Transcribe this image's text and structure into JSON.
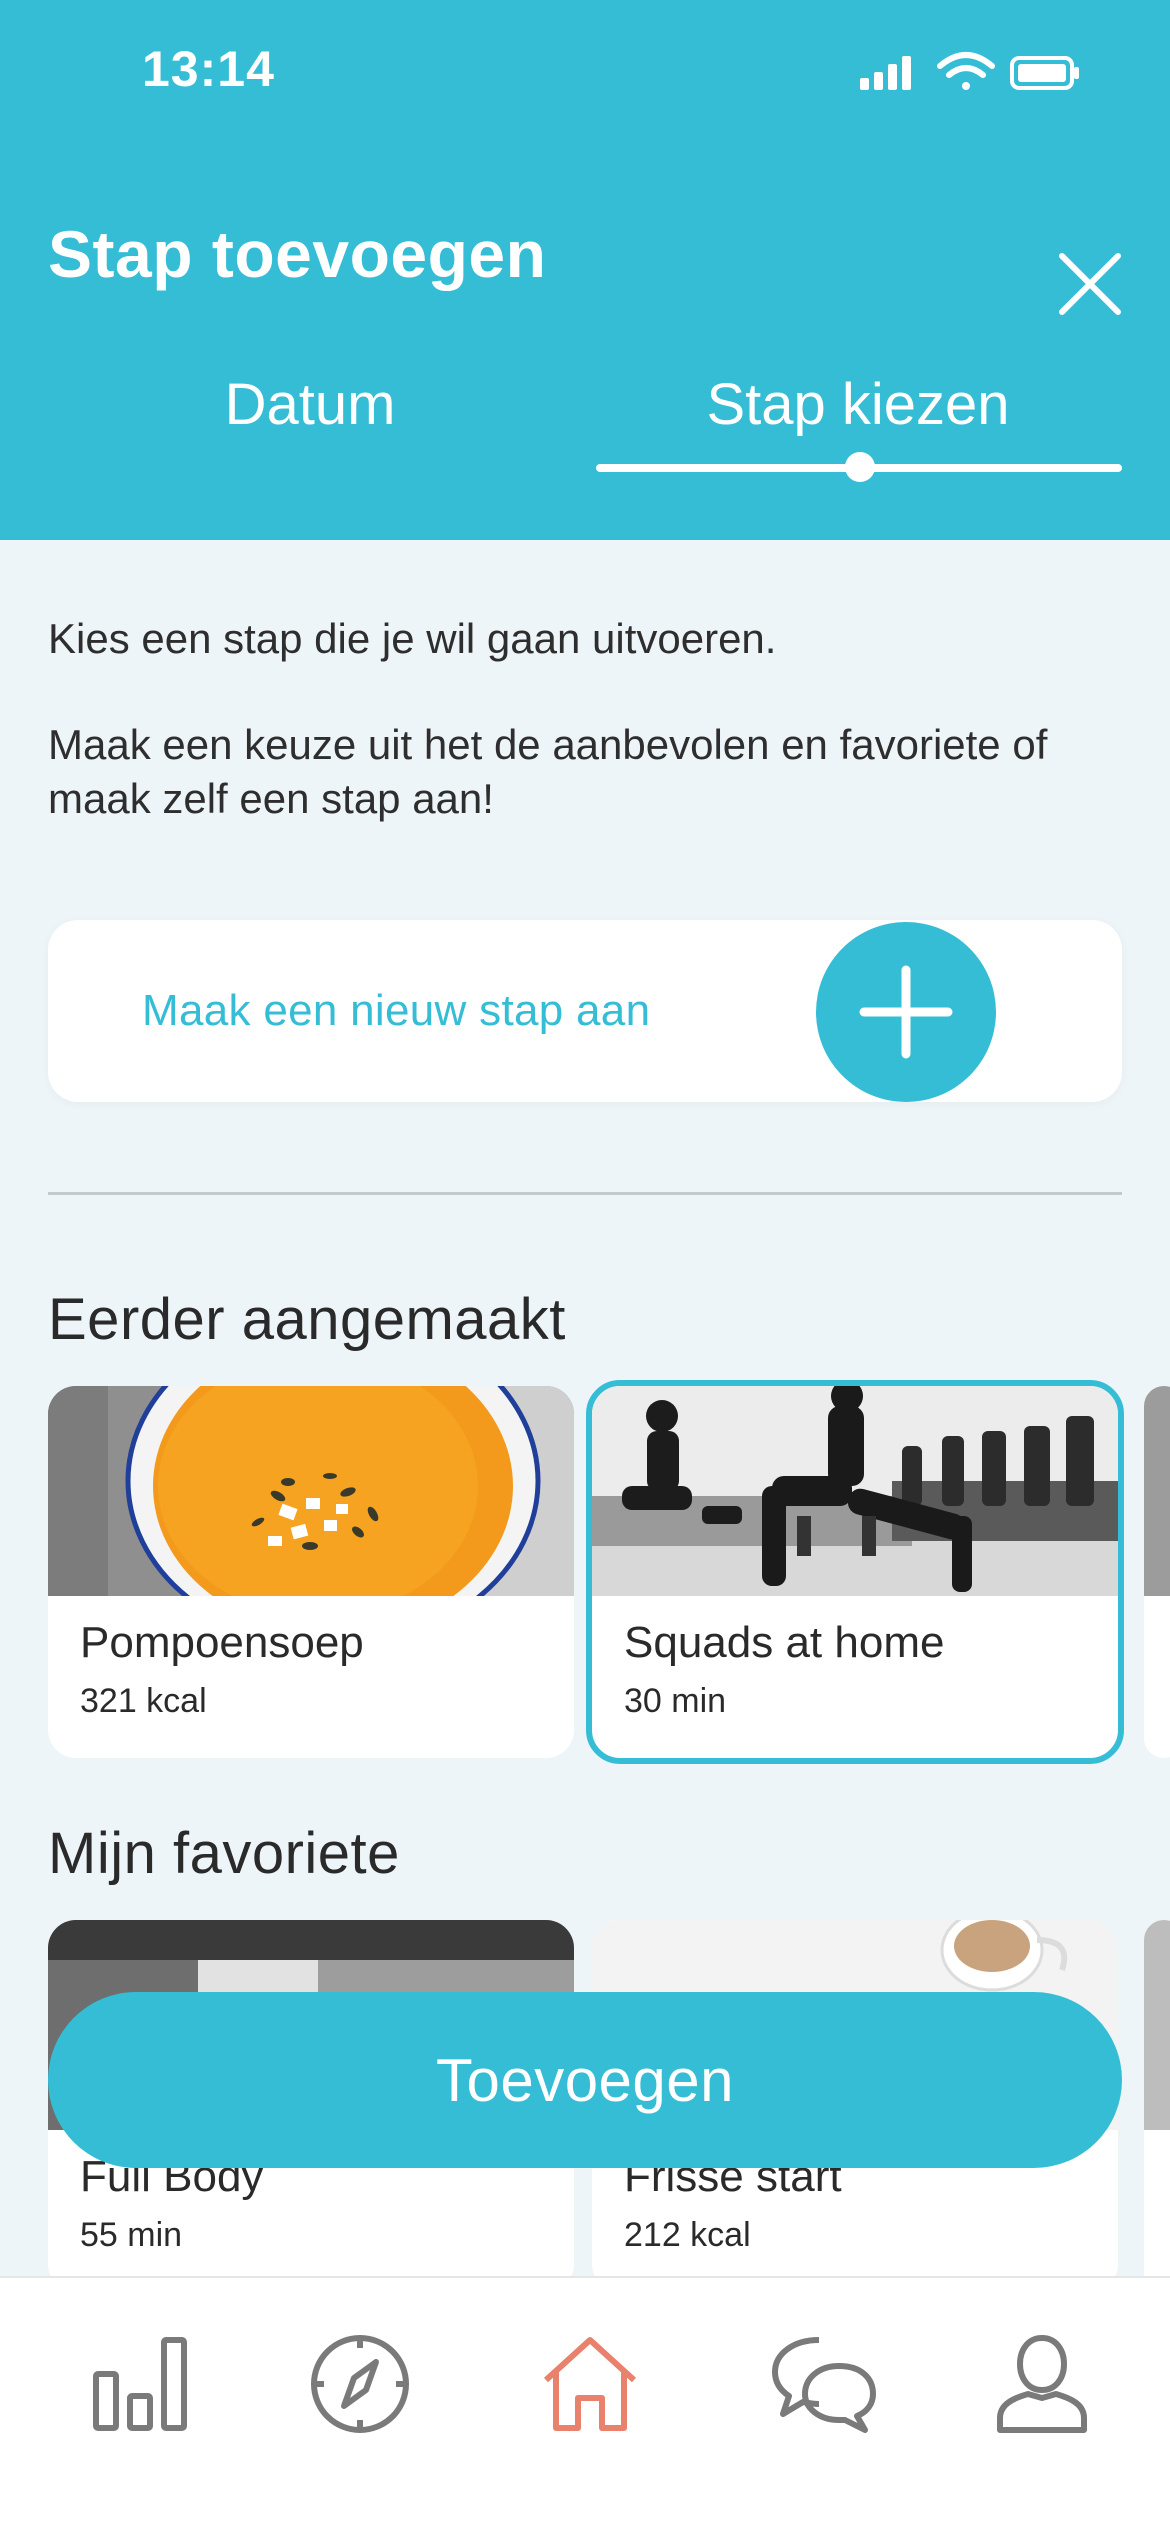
{
  "status_bar": {
    "time": "13:14"
  },
  "header": {
    "title": "Stap toevoegen",
    "tabs": [
      {
        "label": "Datum",
        "active": false
      },
      {
        "label": "Stap kiezen",
        "active": true
      }
    ]
  },
  "intro": {
    "line1": "Kies een stap die je wil gaan uitvoeren.",
    "line2": "Maak een keuze uit het de aanbevolen en favoriete of maak zelf een stap aan!"
  },
  "new_step": {
    "label": "Maak een nieuw stap aan"
  },
  "sections": {
    "previous": {
      "title": "Eerder aangemaakt",
      "cards": [
        {
          "name": "Pompoensoep",
          "meta": "321 kcal",
          "selected": false
        },
        {
          "name": "Squads at home",
          "meta": "30 min",
          "selected": true
        }
      ]
    },
    "favorites": {
      "title": "Mijn favoriete",
      "cards": [
        {
          "name": "Full Body",
          "meta": "55 min"
        },
        {
          "name": "Frisse start",
          "meta": "212 kcal"
        }
      ]
    }
  },
  "actions": {
    "add_label": "Toevoegen"
  },
  "bottom_nav": {
    "items": [
      {
        "icon": "bar-chart-icon",
        "active": false
      },
      {
        "icon": "compass-icon",
        "active": false
      },
      {
        "icon": "home-icon",
        "active": true
      },
      {
        "icon": "chat-icon",
        "active": false
      },
      {
        "icon": "profile-icon",
        "active": false
      }
    ]
  },
  "colors": {
    "accent": "#35bdd6",
    "background": "#eef5f9",
    "nav_active": "#e8826d",
    "nav_inactive": "#7a7a7a"
  }
}
